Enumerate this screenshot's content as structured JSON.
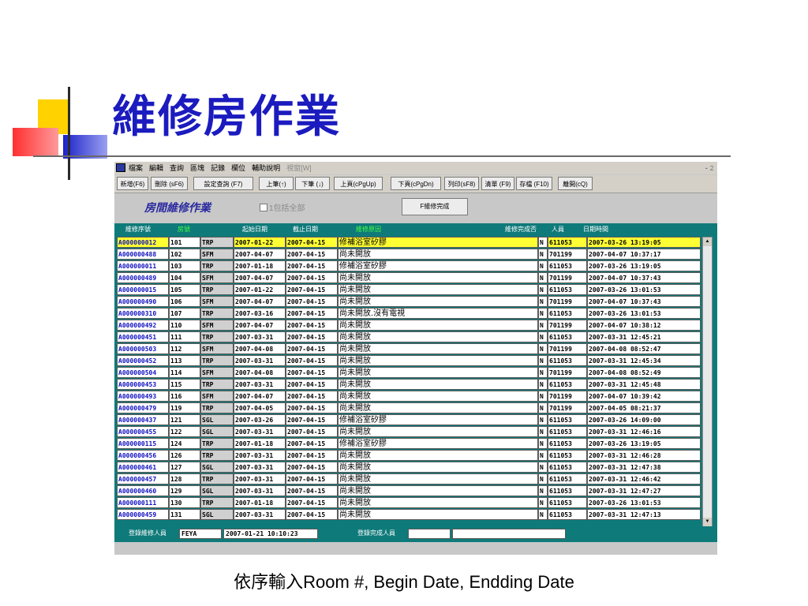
{
  "slide": {
    "title": "維修房作業",
    "caption": "依序輸入Room #, Begin Date, Endding Date"
  },
  "app": {
    "menu": [
      "檔案",
      "編輯",
      "查詢",
      "區塊",
      "記錄",
      "欄位",
      "輔助說明",
      "視窗[W]"
    ],
    "window_controls": "- 𝟸",
    "toolbar": [
      "新增(F6)",
      "刪除 (sF6)",
      "設定查詢 (F7)",
      "上筆(↑)",
      "下筆 (↓)",
      "上頁(cPgUp)",
      "下頁(cPgDn)",
      "列印(sF8)",
      "清單 (F9)",
      "存檔 (F10)",
      "離開(cQ)"
    ],
    "form_title": "房間維修作業",
    "show_all_label": "1包括全部",
    "complete_button": "F維修完成",
    "columns": {
      "seq": "維修序號",
      "room": "房號",
      "begin": "起始日期",
      "end": "截止日期",
      "reason": "維修原因",
      "done": "維修完成否",
      "staff": "人員",
      "datetime": "日期時間"
    },
    "rows": [
      {
        "seq": "A000000012",
        "room": "101",
        "type": "TRP",
        "begin": "2007-01-22",
        "end": "2007-04-15",
        "reason": "修補浴室矽膠",
        "done": "N",
        "staff": "611053",
        "dt": "2007-03-26  13:19:05"
      },
      {
        "seq": "A000000488",
        "room": "102",
        "type": "SFM",
        "begin": "2007-04-07",
        "end": "2007-04-15",
        "reason": "尚未開放",
        "done": "N",
        "staff": "701199",
        "dt": "2007-04-07  10:37:17"
      },
      {
        "seq": "A000000011",
        "room": "103",
        "type": "TRP",
        "begin": "2007-01-18",
        "end": "2007-04-15",
        "reason": "修補浴室矽膠",
        "done": "N",
        "staff": "611053",
        "dt": "2007-03-26  13:19:05"
      },
      {
        "seq": "A000000489",
        "room": "104",
        "type": "SFM",
        "begin": "2007-04-07",
        "end": "2007-04-15",
        "reason": "尚未開放",
        "done": "N",
        "staff": "701199",
        "dt": "2007-04-07  10:37:43"
      },
      {
        "seq": "A000000015",
        "room": "105",
        "type": "TRP",
        "begin": "2007-01-22",
        "end": "2007-04-15",
        "reason": "尚未開放",
        "done": "N",
        "staff": "611053",
        "dt": "2007-03-26  13:01:53"
      },
      {
        "seq": "A000000490",
        "room": "106",
        "type": "SFM",
        "begin": "2007-04-07",
        "end": "2007-04-15",
        "reason": "尚未開放",
        "done": "N",
        "staff": "701199",
        "dt": "2007-04-07  10:37:43"
      },
      {
        "seq": "A000000310",
        "room": "107",
        "type": "TRP",
        "begin": "2007-03-16",
        "end": "2007-04-15",
        "reason": "尚未開放.沒有電視",
        "done": "N",
        "staff": "611053",
        "dt": "2007-03-26  13:01:53"
      },
      {
        "seq": "A000000492",
        "room": "110",
        "type": "SFM",
        "begin": "2007-04-07",
        "end": "2007-04-15",
        "reason": "尚未開放",
        "done": "N",
        "staff": "701199",
        "dt": "2007-04-07  10:38:12"
      },
      {
        "seq": "A000000451",
        "room": "111",
        "type": "TRP",
        "begin": "2007-03-31",
        "end": "2007-04-15",
        "reason": "尚未開放",
        "done": "N",
        "staff": "611053",
        "dt": "2007-03-31  12:45:21"
      },
      {
        "seq": "A000000503",
        "room": "112",
        "type": "SFM",
        "begin": "2007-04-08",
        "end": "2007-04-15",
        "reason": "尚未開放",
        "done": "N",
        "staff": "701199",
        "dt": "2007-04-08  08:52:47"
      },
      {
        "seq": "A000000452",
        "room": "113",
        "type": "TRP",
        "begin": "2007-03-31",
        "end": "2007-04-15",
        "reason": "尚未開放",
        "done": "N",
        "staff": "611053",
        "dt": "2007-03-31  12:45:34"
      },
      {
        "seq": "A000000504",
        "room": "114",
        "type": "SFM",
        "begin": "2007-04-08",
        "end": "2007-04-15",
        "reason": "尚未開放",
        "done": "N",
        "staff": "701199",
        "dt": "2007-04-08  08:52:49"
      },
      {
        "seq": "A000000453",
        "room": "115",
        "type": "TRP",
        "begin": "2007-03-31",
        "end": "2007-04-15",
        "reason": "尚未開放",
        "done": "N",
        "staff": "611053",
        "dt": "2007-03-31  12:45:48"
      },
      {
        "seq": "A000000493",
        "room": "116",
        "type": "SFM",
        "begin": "2007-04-07",
        "end": "2007-04-15",
        "reason": "尚未開放",
        "done": "N",
        "staff": "701199",
        "dt": "2007-04-07  10:39:42"
      },
      {
        "seq": "A000000479",
        "room": "119",
        "type": "TRP",
        "begin": "2007-04-05",
        "end": "2007-04-15",
        "reason": "尚未開放",
        "done": "N",
        "staff": "701199",
        "dt": "2007-04-05  08:21:37"
      },
      {
        "seq": "A000000437",
        "room": "121",
        "type": "SGL",
        "begin": "2007-03-26",
        "end": "2007-04-15",
        "reason": "修補浴室矽膠",
        "done": "N",
        "staff": "611053",
        "dt": "2007-03-26  14:09:00"
      },
      {
        "seq": "A000000455",
        "room": "122",
        "type": "SGL",
        "begin": "2007-03-31",
        "end": "2007-04-15",
        "reason": "尚未開放",
        "done": "N",
        "staff": "611053",
        "dt": "2007-03-31  12:46:16"
      },
      {
        "seq": "A000000115",
        "room": "124",
        "type": "TRP",
        "begin": "2007-01-18",
        "end": "2007-04-15",
        "reason": "修補浴室矽膠",
        "done": "N",
        "staff": "611053",
        "dt": "2007-03-26  13:19:05"
      },
      {
        "seq": "A000000456",
        "room": "126",
        "type": "TRP",
        "begin": "2007-03-31",
        "end": "2007-04-15",
        "reason": "尚未開放",
        "done": "N",
        "staff": "611053",
        "dt": "2007-03-31  12:46:28"
      },
      {
        "seq": "A000000461",
        "room": "127",
        "type": "SGL",
        "begin": "2007-03-31",
        "end": "2007-04-15",
        "reason": "尚未開放",
        "done": "N",
        "staff": "611053",
        "dt": "2007-03-31  12:47:38"
      },
      {
        "seq": "A000000457",
        "room": "128",
        "type": "TRP",
        "begin": "2007-03-31",
        "end": "2007-04-15",
        "reason": "尚未開放",
        "done": "N",
        "staff": "611053",
        "dt": "2007-03-31  12:46:42"
      },
      {
        "seq": "A000000460",
        "room": "129",
        "type": "SGL",
        "begin": "2007-03-31",
        "end": "2007-04-15",
        "reason": "尚未開放",
        "done": "N",
        "staff": "611053",
        "dt": "2007-03-31  12:47:27"
      },
      {
        "seq": "A000000111",
        "room": "130",
        "type": "TRP",
        "begin": "2007-01-18",
        "end": "2007-04-15",
        "reason": "尚未開放",
        "done": "N",
        "staff": "611053",
        "dt": "2007-03-26  13:01:53"
      },
      {
        "seq": "A000000459",
        "room": "131",
        "type": "SGL",
        "begin": "2007-03-31",
        "end": "2007-04-15",
        "reason": "尚未開放",
        "done": "N",
        "staff": "611053",
        "dt": "2007-03-31  12:47:13"
      }
    ],
    "footer": {
      "register_label": "登錄維修人員",
      "register_user": "FEYA",
      "register_time": "2007-01-21  10:10:23",
      "complete_label": "登錄完成人員",
      "complete_user": "",
      "complete_extra": ""
    }
  },
  "colors": {
    "title": "#1b1bbf",
    "grid_bg": "#0f7a7a",
    "selected_row": "#ffff33"
  }
}
